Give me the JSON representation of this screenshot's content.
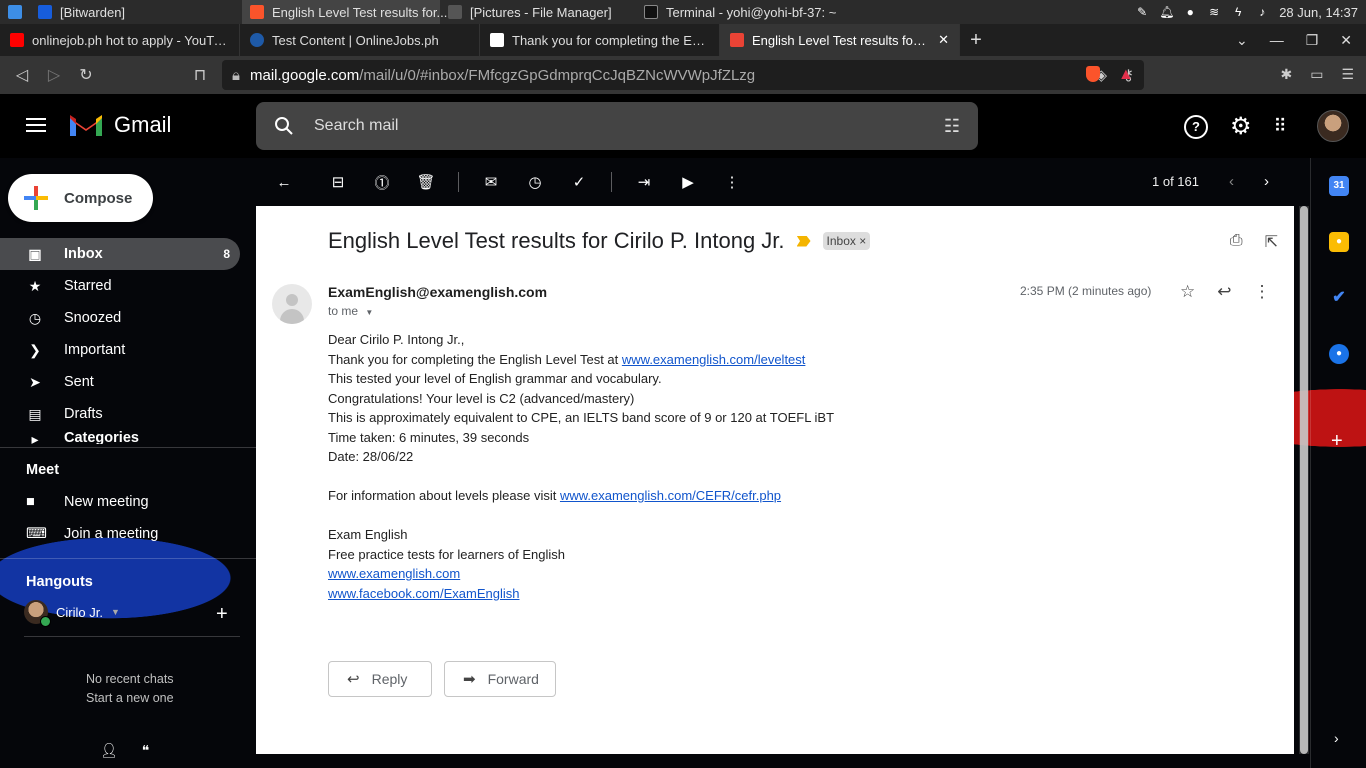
{
  "os_taskbar": {
    "tasks": [
      {
        "label": "[Bitwarden]"
      },
      {
        "label": "English Level Test results for..."
      },
      {
        "label": "[Pictures - File Manager]"
      },
      {
        "label": "Terminal - yohi@yohi-bf-37: ~"
      }
    ],
    "clock": "28 Jun, 14:37"
  },
  "browser": {
    "tabs": [
      {
        "title": "onlinejob.ph hot to apply - YouTube"
      },
      {
        "title": "Test Content | OnlineJobs.ph"
      },
      {
        "title": "Thank you for completing the English"
      },
      {
        "title": "English Level Test results for Cirilo"
      }
    ],
    "url_host": "mail.google.com",
    "url_path": "/mail/u/0/#inbox/FMfcgzGpGdmprqCcJqBZNcWVWpJfZLzg"
  },
  "gmail": {
    "logo_text": "Gmail",
    "search_placeholder": "Search mail",
    "compose_label": "Compose",
    "nav": [
      {
        "label": "Inbox",
        "count": "8",
        "icon": "inbox-icon"
      },
      {
        "label": "Starred",
        "count": "",
        "icon": "star-icon"
      },
      {
        "label": "Snoozed",
        "count": "",
        "icon": "clock-icon"
      },
      {
        "label": "Important",
        "count": "",
        "icon": "important-icon"
      },
      {
        "label": "Sent",
        "count": "",
        "icon": "send-icon"
      },
      {
        "label": "Drafts",
        "count": "",
        "icon": "draft-icon"
      },
      {
        "label": "Categories",
        "count": "",
        "icon": "label-icon"
      }
    ],
    "meet": {
      "title": "Meet",
      "new_meeting": "New meeting",
      "join_meeting": "Join a meeting"
    },
    "hangouts": {
      "title": "Hangouts",
      "user": "Cirilo Jr.",
      "no_chats": "No recent chats",
      "start_new": "Start a new one"
    },
    "pager": "1 of 161"
  },
  "message": {
    "subject": "English Level Test results for Cirilo P. Intong Jr.",
    "label": "Inbox",
    "sender": "ExamEnglish@examenglish.com",
    "to": "to me",
    "time": "2:35 PM (2 minutes ago)",
    "greeting": "Dear Cirilo P. Intong Jr.,",
    "line1_prefix": "Thank you for completing the English Level Test at ",
    "line1_link": "www.examenglish.com/leveltest",
    "line2": "This tested your level of English grammar and vocabulary.",
    "line3": "Congratulations! Your level is C2 (advanced/mastery)",
    "line4": "This is approximately equivalent to CPE, an IELTS band score of 9 or 120 at TOEFL iBT",
    "line5": "Time taken: 6 minutes, 39 seconds",
    "line6": "Date: 28/06/22",
    "info_prefix": "For information about levels please visit ",
    "info_link": "www.examenglish.com/CEFR/cefr.php",
    "sig_name": "Exam English",
    "sig_tagline": "Free practice tests for learners of English",
    "sig_link1": "www.examenglish.com",
    "sig_link2": "www.facebook.com/ExamEnglish",
    "reply_label": "Reply",
    "forward_label": "Forward"
  }
}
